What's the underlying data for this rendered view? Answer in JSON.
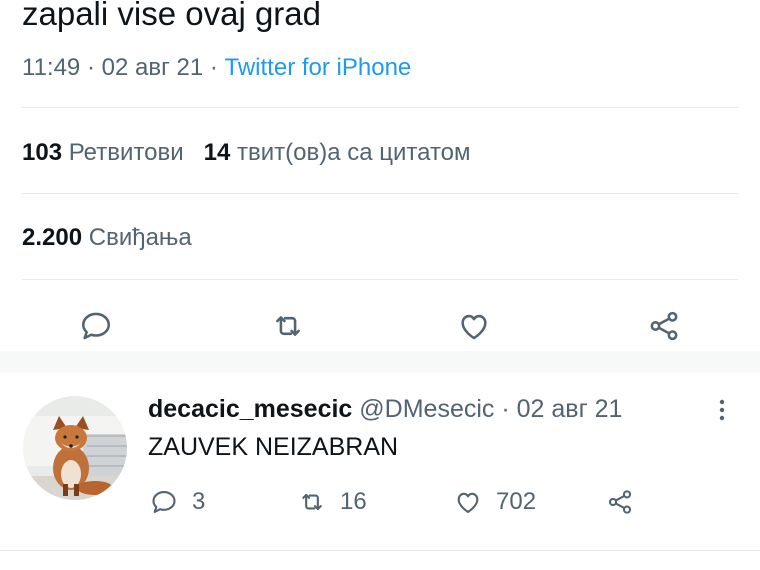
{
  "tweet": {
    "text": "zapali vise ovaj grad",
    "time": "11:49",
    "sep": " · ",
    "date": "02 авг 21",
    "source": "Twitter for iPhone"
  },
  "stats": {
    "retweets_count": "103",
    "retweets_label": "Ретвитови",
    "quotes_count": "14",
    "quotes_label": "твит(ов)а са цитатом",
    "likes_count": "2.200",
    "likes_label": "Свиђања"
  },
  "actions": {
    "icons": [
      "reply-icon",
      "retweet-icon",
      "like-icon",
      "share-icon"
    ],
    "color": "#536471"
  },
  "reply": {
    "display_name": "decacic_mesecic",
    "handle": "@DMesecic",
    "sep": " · ",
    "date": "02 авг 21",
    "text": "ZAUVEK NEIZABRAN",
    "reply_count": "3",
    "retweet_count": "16",
    "like_count": "702"
  },
  "colors": {
    "accent": "#1d9bf0",
    "text": "#0f1419",
    "secondary": "#536471",
    "divider": "#e6ecf0"
  }
}
